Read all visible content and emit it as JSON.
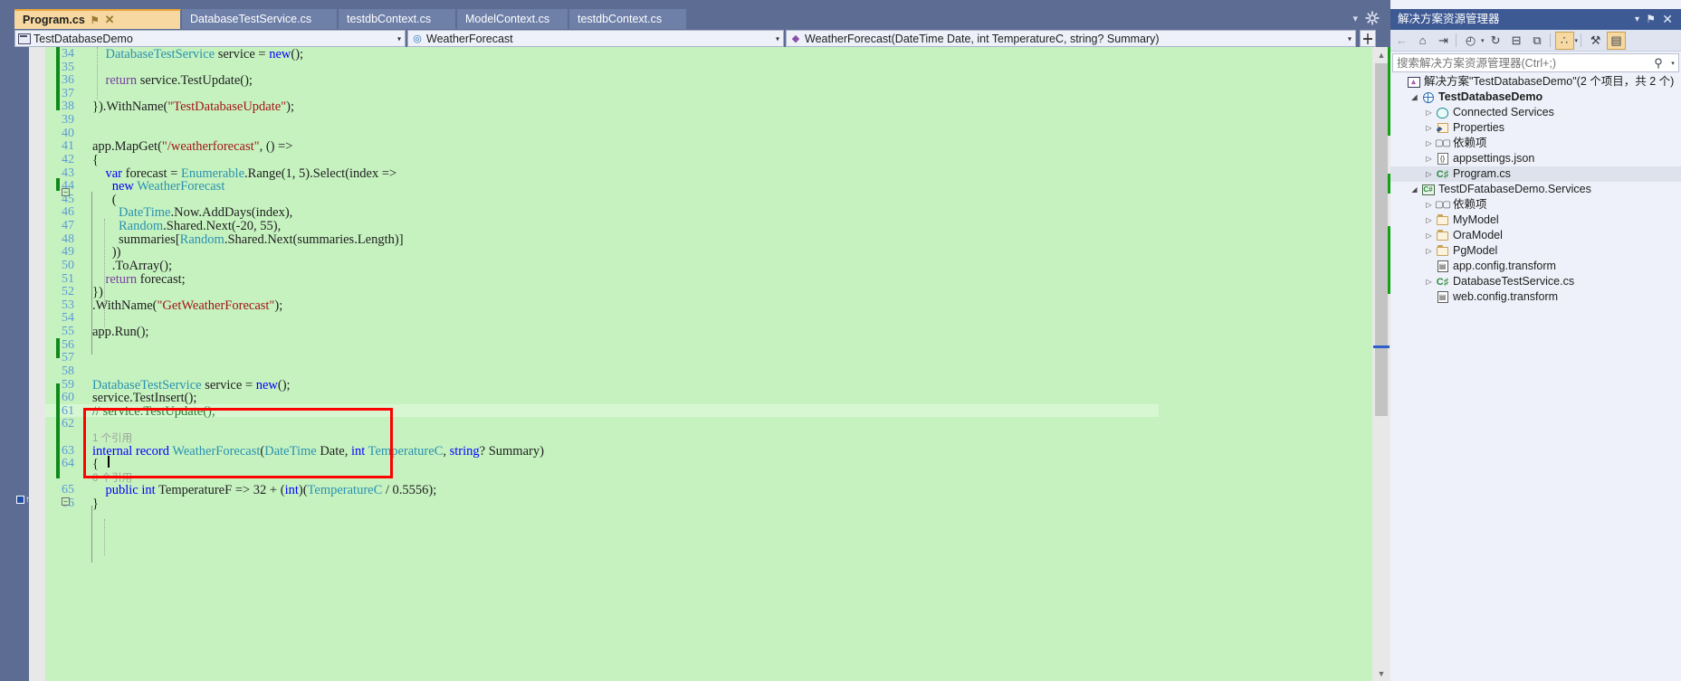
{
  "tabs": [
    {
      "label": "Program.cs",
      "active": true,
      "pin": "⚑",
      "close": "✕"
    },
    {
      "label": "DatabaseTestService.cs",
      "active": false
    },
    {
      "label": "testdbContext.cs",
      "active": false
    },
    {
      "label": "ModelContext.cs",
      "active": false
    },
    {
      "label": "testdbContext.cs",
      "active": false
    }
  ],
  "tabstrip": {
    "chevron": "▾",
    "gear_name": "tab-options-gear"
  },
  "navbar": {
    "project": "TestDatabaseDemo",
    "type": "WeatherForecast",
    "member": "WeatherForecast(DateTime Date, int TemperatureC, string? Summary)",
    "arrow": "▾",
    "split_label": "≡"
  },
  "editor": {
    "first_line": 34,
    "last_line": 66,
    "codelens": [
      {
        "line": 62,
        "text": "1 个引用"
      },
      {
        "line": 64,
        "text": "0 个引用"
      }
    ],
    "lines": [
      {
        "n": 34,
        "text": "    DatabaseTestService service = new();"
      },
      {
        "n": 35,
        "text": ""
      },
      {
        "n": 36,
        "text": "    return service.TestUpdate();"
      },
      {
        "n": 37,
        "text": ""
      },
      {
        "n": 38,
        "text": "}).WithName(\"TestDatabaseUpdate\");"
      },
      {
        "n": 39,
        "text": ""
      },
      {
        "n": 40,
        "text": ""
      },
      {
        "n": 41,
        "text": "app.MapGet(\"/weatherforecast\", () =>"
      },
      {
        "n": 42,
        "text": "{"
      },
      {
        "n": 43,
        "text": "    var forecast = Enumerable.Range(1, 5).Select(index =>"
      },
      {
        "n": 44,
        "text": "      new WeatherForecast"
      },
      {
        "n": 45,
        "text": "      ("
      },
      {
        "n": 46,
        "text": "        DateTime.Now.AddDays(index),"
      },
      {
        "n": 47,
        "text": "        Random.Shared.Next(-20, 55),"
      },
      {
        "n": 48,
        "text": "        summaries[Random.Shared.Next(summaries.Length)]"
      },
      {
        "n": 49,
        "text": "      ))"
      },
      {
        "n": 50,
        "text": "      .ToArray();"
      },
      {
        "n": 51,
        "text": "    return forecast;"
      },
      {
        "n": 52,
        "text": "})"
      },
      {
        "n": 53,
        "text": ".WithName(\"GetWeatherForecast\");"
      },
      {
        "n": 54,
        "text": ""
      },
      {
        "n": 55,
        "text": "app.Run();"
      },
      {
        "n": 56,
        "text": ""
      },
      {
        "n": 57,
        "text": ""
      },
      {
        "n": 58,
        "text": ""
      },
      {
        "n": 59,
        "text": "DatabaseTestService service = new();"
      },
      {
        "n": 60,
        "text": "service.TestInsert();"
      },
      {
        "n": 61,
        "text": "// service.TestUpdate();"
      },
      {
        "n": 62,
        "text": ""
      },
      {
        "n": 63,
        "text": "internal record WeatherForecast(DateTime Date, int TemperatureC, string? Summary)"
      },
      {
        "n": 64,
        "text": "{"
      },
      {
        "n": 65,
        "text": "    public int TemperatureF => 32 + (int)(TemperatureC / 0.5556);"
      },
      {
        "n": 66,
        "text": "}"
      }
    ],
    "background_color": "#c6f2c0",
    "annotation_box_color": "#fe0000",
    "change_bar_color": "#0f8a19",
    "scrollbar": {
      "up": "▲",
      "down": "▼"
    }
  },
  "solution_explorer": {
    "title": "解决方案资源管理器",
    "title_buttons": {
      "chevron": "▾",
      "pin": "⚑",
      "close": "✕"
    },
    "toolbar": [
      {
        "name": "back-icon",
        "glyph": "←",
        "selected": false,
        "dim": true
      },
      {
        "name": "home-icon",
        "glyph": "⌂",
        "selected": false
      },
      {
        "name": "sync-with-active-document-icon",
        "glyph": "⇥",
        "selected": false
      },
      {
        "name": "pending-changes-icon",
        "glyph": "◴",
        "selected": false,
        "caret": true
      },
      {
        "name": "refresh-icon",
        "glyph": "↻",
        "selected": false
      },
      {
        "name": "collapse-all-icon",
        "glyph": "⊟",
        "selected": false
      },
      {
        "name": "show-all-files-icon",
        "glyph": "⧉",
        "selected": false
      },
      {
        "name": "view-options-icon",
        "glyph": "∴",
        "selected": true,
        "caret": true
      },
      {
        "name": "properties-wrench-icon",
        "glyph": "⚒",
        "selected": false
      },
      {
        "name": "preview-selected-items-icon",
        "glyph": "▤",
        "selected": true
      }
    ],
    "search": {
      "placeholder": "搜索解决方案资源管理器(Ctrl+;)",
      "value": "",
      "mag": "⚲",
      "caret": "▾"
    },
    "tree": [
      {
        "depth": 0,
        "expander": "",
        "icon": "solution-icon",
        "label": "解决方案\"TestDatabaseDemo\"(2 个项目，共 2 个)",
        "bold": false,
        "selected": false
      },
      {
        "depth": 1,
        "expander": "◢",
        "icon": "project-web-icon",
        "label": "TestDatabaseDemo",
        "bold": true,
        "selected": false
      },
      {
        "depth": 2,
        "expander": "▷",
        "icon": "connected-services-icon",
        "label": "Connected Services",
        "bold": false,
        "selected": false
      },
      {
        "depth": 2,
        "expander": "▷",
        "icon": "properties-icon",
        "label": "Properties",
        "bold": false,
        "selected": false
      },
      {
        "depth": 2,
        "expander": "▷",
        "icon": "dependencies-icon",
        "label": "依赖项",
        "bold": false,
        "selected": false
      },
      {
        "depth": 2,
        "expander": "▷",
        "icon": "json-file-icon",
        "label": "appsettings.json",
        "bold": false,
        "selected": false
      },
      {
        "depth": 2,
        "expander": "▷",
        "icon": "csharp-file-icon",
        "label": "Program.cs",
        "bold": false,
        "selected": true
      },
      {
        "depth": 1,
        "expander": "◢",
        "icon": "csharp-project-icon",
        "label": "TestDFatabaseDemo.Services",
        "bold": false,
        "selected": false
      },
      {
        "depth": 2,
        "expander": "▷",
        "icon": "dependencies-icon",
        "label": "依赖项",
        "bold": false,
        "selected": false
      },
      {
        "depth": 2,
        "expander": "▷",
        "icon": "folder-icon",
        "label": "MyModel",
        "bold": false,
        "selected": false
      },
      {
        "depth": 2,
        "expander": "▷",
        "icon": "folder-icon",
        "label": "OraModel",
        "bold": false,
        "selected": false
      },
      {
        "depth": 2,
        "expander": "▷",
        "icon": "folder-icon",
        "label": "PgModel",
        "bold": false,
        "selected": false
      },
      {
        "depth": 2,
        "expander": "",
        "icon": "config-file-icon",
        "label": "app.config.transform",
        "bold": false,
        "selected": false
      },
      {
        "depth": 2,
        "expander": "▷",
        "icon": "csharp-file-icon",
        "label": "DatabaseTestService.cs",
        "bold": false,
        "selected": false
      },
      {
        "depth": 2,
        "expander": "",
        "icon": "config-file-icon",
        "label": "web.config.transform",
        "bold": false,
        "selected": false
      }
    ]
  }
}
